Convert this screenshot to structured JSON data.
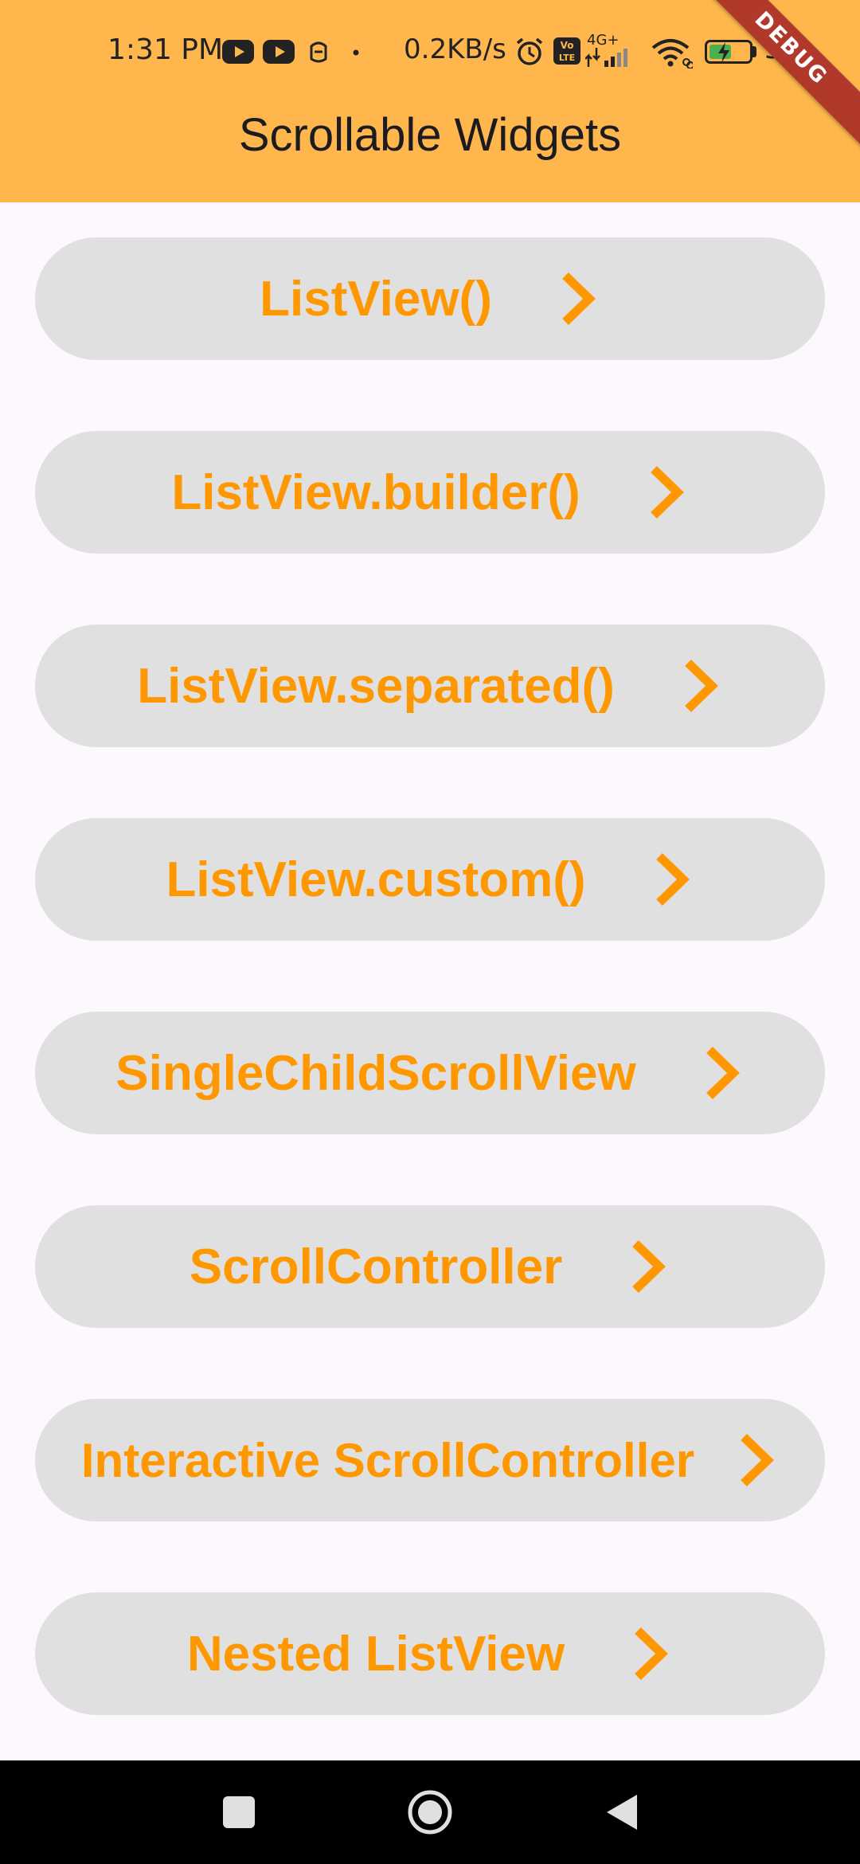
{
  "status_bar": {
    "time": "1:31 PM",
    "network_speed": "0.2KB/s",
    "network_type": "4G+",
    "volte": "Vo LTE",
    "battery_percent": "57"
  },
  "debug_banner": "DEBUG",
  "app_bar": {
    "title": "Scrollable Widgets",
    "background_color": "#ffb74d"
  },
  "menu": {
    "items": [
      {
        "label": "ListView()"
      },
      {
        "label": "ListView.builder()"
      },
      {
        "label": "ListView.separated()"
      },
      {
        "label": "ListView.custom()"
      },
      {
        "label": "SingleChildScrollView"
      },
      {
        "label": "ScrollController"
      },
      {
        "label": "Interactive ScrollController"
      },
      {
        "label": "Nested ListView"
      }
    ],
    "label_color": "#ff9800",
    "button_color": "#e0e0e0",
    "icon": "chevron-right-icon"
  },
  "nav_bar": {
    "items": [
      "recent-apps-icon",
      "home-icon",
      "back-icon"
    ]
  }
}
